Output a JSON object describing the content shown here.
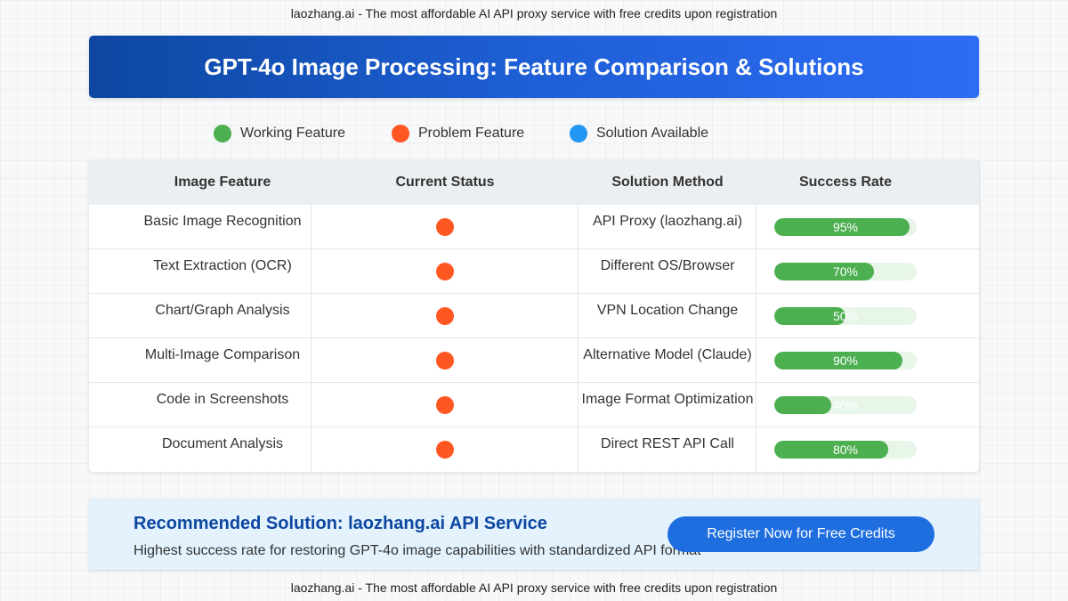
{
  "banner": {
    "top": "laozhang.ai - The most affordable AI API proxy service with free credits upon registration",
    "bottom": "laozhang.ai - The most affordable AI API proxy service with free credits upon registration"
  },
  "title": "GPT-4o Image Processing: Feature Comparison & Solutions",
  "legend": [
    {
      "label": "Working Feature",
      "color": "#4caf50"
    },
    {
      "label": "Problem Feature",
      "color": "#ff5722"
    },
    {
      "label": "Solution Available",
      "color": "#2196f3"
    }
  ],
  "table": {
    "headers": [
      "Image Feature",
      "Current Status",
      "Solution Method",
      "Success Rate"
    ],
    "rows": [
      {
        "feature": "Basic Image Recognition",
        "status": "problem",
        "solution": "API Proxy (laozhang.ai)",
        "rate": 95,
        "rate_label": "95%"
      },
      {
        "feature": "Text Extraction (OCR)",
        "status": "problem",
        "solution": "Different OS/Browser",
        "rate": 70,
        "rate_label": "70%"
      },
      {
        "feature": "Chart/Graph Analysis",
        "status": "problem",
        "solution": "VPN Location Change",
        "rate": 50,
        "rate_label": "50%"
      },
      {
        "feature": "Multi-Image Comparison",
        "status": "problem",
        "solution": "Alternative Model (Claude)",
        "rate": 90,
        "rate_label": "90%"
      },
      {
        "feature": "Code in Screenshots",
        "status": "problem",
        "solution": "Image Format Optimization",
        "rate": 40,
        "rate_label": "40%"
      },
      {
        "feature": "Document Analysis",
        "status": "problem",
        "solution": "Direct REST API Call",
        "rate": 80,
        "rate_label": "80%"
      }
    ]
  },
  "colors": {
    "working": "#4caf50",
    "problem": "#ff5722",
    "solution": "#2196f3"
  },
  "recommendation": {
    "title": "Recommended Solution: laozhang.ai API Service",
    "description": "Highest success rate for restoring GPT-4o image capabilities with standardized API format",
    "button_label": "Register Now for Free Credits"
  }
}
